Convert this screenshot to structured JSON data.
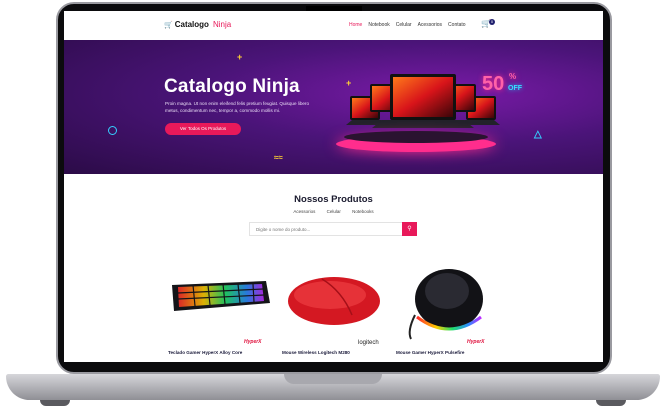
{
  "nav": {
    "brand_main": "Catalogo",
    "brand_accent": "Ninja",
    "links": [
      "Home",
      "Notebook",
      "Celular",
      "Acessorios",
      "Contato"
    ],
    "cart_count": "0"
  },
  "hero": {
    "title": "Catalogo Ninja",
    "subtitle": "Proin magna. Ut non enim eleifend felis pretium feugiat. Quisque libero metus, condimentum nec, tempor a, commodo mollis mi.",
    "cta_label": "Ver Todos Os Produtos",
    "promo_number": "50",
    "promo_percent": "%",
    "promo_off": "OFF"
  },
  "products": {
    "title": "Nossos Produtos",
    "filters": [
      "Acessorios",
      "Celular",
      "Notebooks"
    ],
    "search_placeholder": "Digite o nome do produto...",
    "items": [
      {
        "name": "Teclado Gamer HyperX Alloy Core",
        "brand": "HyperX"
      },
      {
        "name": "Mouse Wireless Logitech M280",
        "brand": "logitech"
      },
      {
        "name": "Mouse Gamer HyperX Pulsefire",
        "brand": "HyperX"
      }
    ]
  },
  "colors": {
    "accent": "#e8195a",
    "hero_dark": "#2b0b47",
    "hero_mid": "#7a1aa8"
  }
}
